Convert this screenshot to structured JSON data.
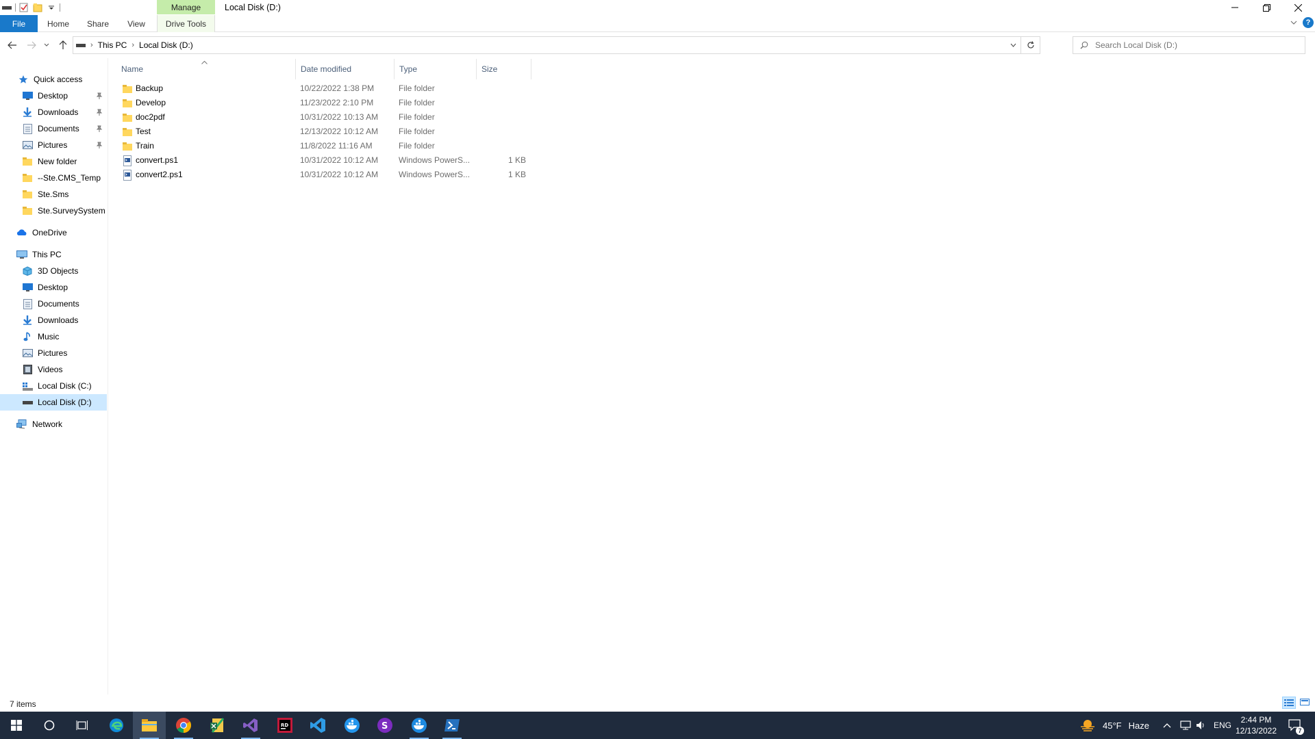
{
  "window": {
    "title": "Local Disk (D:)",
    "contextual_tab_group": "Manage"
  },
  "ribbon": {
    "tabs": [
      "File",
      "Home",
      "Share",
      "View",
      "Drive Tools"
    ],
    "help_label": "?"
  },
  "address": {
    "crumbs": [
      "This PC",
      "Local Disk (D:)"
    ]
  },
  "search": {
    "placeholder": "Search Local Disk (D:)"
  },
  "nav": {
    "quick_access": "Quick access",
    "quick_items": [
      "Desktop",
      "Downloads",
      "Documents",
      "Pictures",
      "New folder",
      "--Ste.CMS_Temp",
      "Ste.Sms",
      "Ste.SurveySystem"
    ],
    "onedrive": "OneDrive",
    "this_pc": "This PC",
    "pc_items": [
      "3D Objects",
      "Desktop",
      "Documents",
      "Downloads",
      "Music",
      "Pictures",
      "Videos",
      "Local Disk (C:)",
      "Local Disk (D:)"
    ],
    "network": "Network"
  },
  "columns": {
    "name": "Name",
    "date": "Date modified",
    "type": "Type",
    "size": "Size"
  },
  "files": [
    {
      "name": "Backup",
      "date": "10/22/2022 1:38 PM",
      "type": "File folder",
      "size": "",
      "kind": "folder"
    },
    {
      "name": "Develop",
      "date": "11/23/2022 2:10 PM",
      "type": "File folder",
      "size": "",
      "kind": "folder"
    },
    {
      "name": "doc2pdf",
      "date": "10/31/2022 10:13 AM",
      "type": "File folder",
      "size": "",
      "kind": "folder"
    },
    {
      "name": "Test",
      "date": "12/13/2022 10:12 AM",
      "type": "File folder",
      "size": "",
      "kind": "folder"
    },
    {
      "name": "Train",
      "date": "11/8/2022 11:16 AM",
      "type": "File folder",
      "size": "",
      "kind": "folder"
    },
    {
      "name": "convert.ps1",
      "date": "10/31/2022 10:12 AM",
      "type": "Windows PowerS...",
      "size": "1 KB",
      "kind": "script"
    },
    {
      "name": "convert2.ps1",
      "date": "10/31/2022 10:12 AM",
      "type": "Windows PowerS...",
      "size": "1 KB",
      "kind": "script"
    }
  ],
  "status": {
    "item_count": "7 items"
  },
  "taskbar": {
    "weather_temp": "45°F",
    "weather_desc": "Haze",
    "language": "ENG",
    "time": "2:44 PM",
    "date": "12/13/2022",
    "notification_count": "7"
  },
  "colors": {
    "accent": "#1979ca",
    "manage_tab": "#c5ecaa",
    "selection": "#cce8ff",
    "folder": "#ffd75e",
    "taskbar": "#1f2b3d"
  }
}
